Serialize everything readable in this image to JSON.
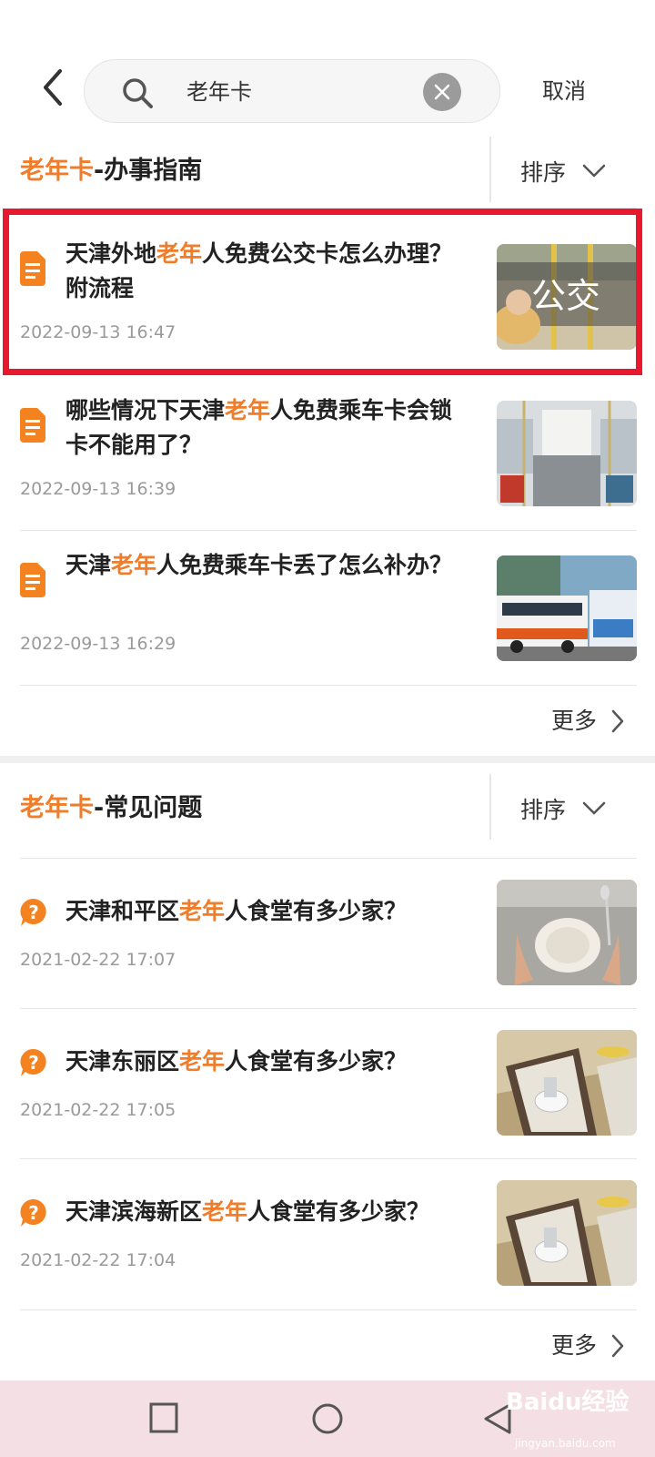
{
  "search": {
    "query": "老年卡",
    "cancel_label": "取消"
  },
  "guide_section": {
    "title_highlight": "老年卡",
    "title_rest": "-办事指南",
    "sort_label": "排序",
    "items": [
      {
        "title_parts": [
          "天津外地",
          "老年",
          "人免费公交卡怎么办理？附流程"
        ],
        "time": "2022-09-13 16:47",
        "thumb_text": "公交"
      },
      {
        "title_parts": [
          "哪些情况下天津",
          "老年",
          "人免费乘车卡会锁卡不能用了？"
        ],
        "time": "2022-09-13 16:39"
      },
      {
        "title_parts": [
          "天津",
          "老年",
          "人免费乘车卡丢了怎么补办？"
        ],
        "time": "2022-09-13 16:29"
      }
    ],
    "more_label": "更多"
  },
  "faq_section": {
    "title_highlight": "老年卡",
    "title_rest": "-常见问题",
    "sort_label": "排序",
    "items": [
      {
        "title_parts": [
          "天津和平区",
          "老年",
          "人食堂有多少家？"
        ],
        "time": "2021-02-22 17:07"
      },
      {
        "title_parts": [
          "天津东丽区",
          "老年",
          "人食堂有多少家？"
        ],
        "time": "2021-02-22 17:05"
      },
      {
        "title_parts": [
          "天津滨海新区",
          "老年",
          "人食堂有多少家？"
        ],
        "time": "2021-02-22 17:04"
      }
    ],
    "more_label": "更多"
  },
  "watermark": {
    "text": "Baidu经验",
    "sub": "jingyan.baidu.com"
  },
  "colors": {
    "accent": "#ef7d2c",
    "highlight_box": "#e8182e",
    "nav_bg": "#f4dfe5"
  },
  "icons": [
    "back-arrow-icon",
    "search-icon",
    "clear-icon",
    "chevron-down-icon",
    "document-icon",
    "question-icon",
    "chevron-right-icon",
    "square-icon",
    "circle-icon",
    "triangle-back-icon"
  ]
}
